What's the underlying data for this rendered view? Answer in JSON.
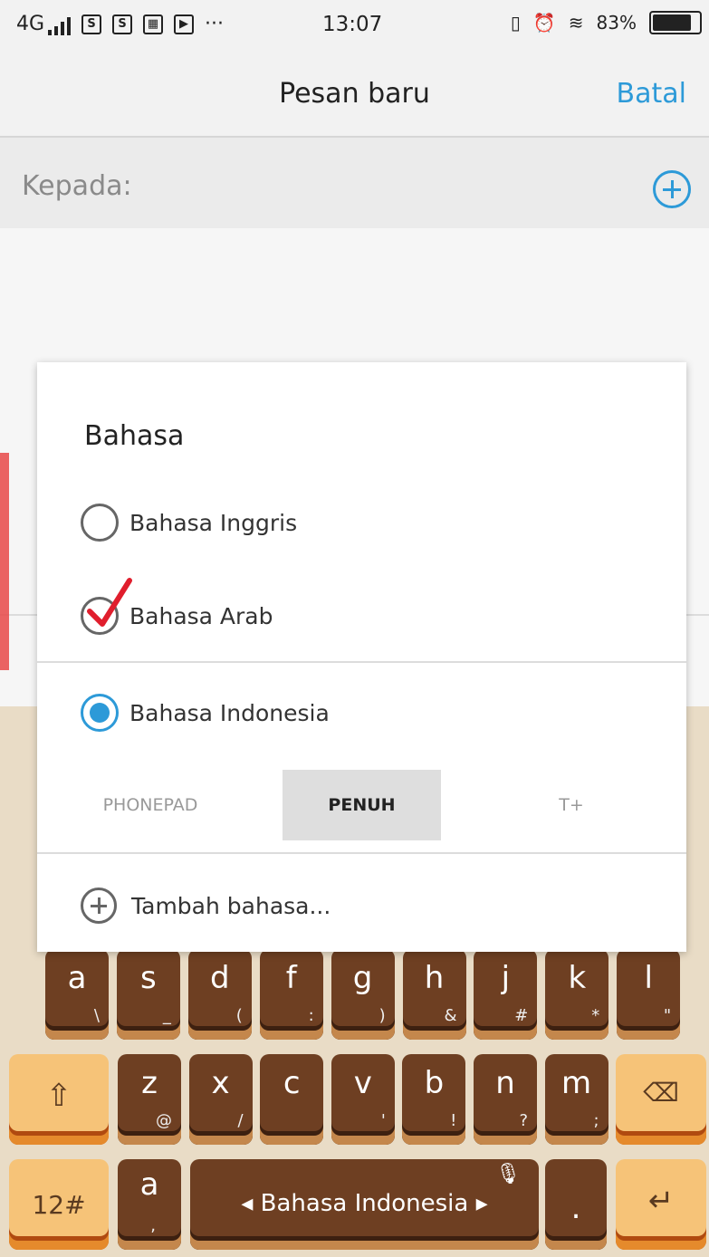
{
  "status_bar": {
    "network": "4G",
    "time": "13:07",
    "battery": "83%",
    "battery_level": 0.83,
    "icons": [
      "signal-icon",
      "s-app-icon",
      "s-app-icon",
      "keyboard-notif-icon",
      "store-icon",
      "more-dots-icon",
      "vibrate-icon",
      "alarm-icon",
      "wifi-icon",
      "battery-icon"
    ]
  },
  "header": {
    "title": "Pesan baru",
    "cancel": "Batal"
  },
  "recipient": {
    "label": "Kepada:"
  },
  "dialog": {
    "title": "Bahasa",
    "options": [
      {
        "label": "Bahasa Inggris",
        "selected": false
      },
      {
        "label": "Bahasa Arab",
        "selected": false,
        "annotated_check": true
      },
      {
        "label": "Bahasa Indonesia",
        "selected": true
      }
    ],
    "layouts": [
      "PHONEPAD",
      "PENUH",
      "T+"
    ],
    "active_layout": "PENUH",
    "add_language": "Tambah bahasa..."
  },
  "keyboard": {
    "row_home": [
      {
        "k": "a",
        "s": "\\"
      },
      {
        "k": "s",
        "s": "_"
      },
      {
        "k": "d",
        "s": "("
      },
      {
        "k": "f",
        "s": ":"
      },
      {
        "k": "g",
        "s": ")"
      },
      {
        "k": "h",
        "s": "&"
      },
      {
        "k": "j",
        "s": "#"
      },
      {
        "k": "k",
        "s": "*"
      },
      {
        "k": "l",
        "s": "\""
      }
    ],
    "row_bottom": [
      {
        "k": "z",
        "s": "@"
      },
      {
        "k": "x",
        "s": "/"
      },
      {
        "k": "c",
        "s": ""
      },
      {
        "k": "v",
        "s": "'"
      },
      {
        "k": "b",
        "s": "!"
      },
      {
        "k": "n",
        "s": "?"
      },
      {
        "k": "m",
        "s": ";"
      }
    ],
    "symbols_key": "12#",
    "comma_key": "a",
    "comma_sub": ",",
    "space_label": "Bahasa Indonesia",
    "period_key": "."
  },
  "colors": {
    "accent": "#2d9ad8",
    "key_brown": "#6e3f22",
    "key_orange": "#f6c378",
    "check_red": "#e01e2d"
  }
}
